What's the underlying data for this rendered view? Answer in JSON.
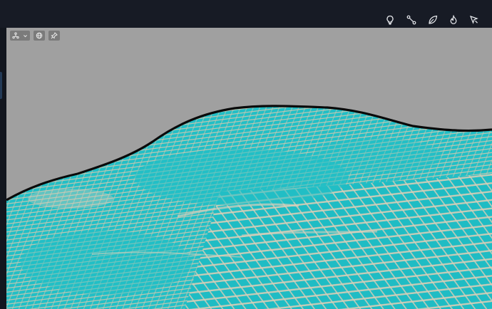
{
  "app": {
    "colors": {
      "topbar_bg": "#171b25",
      "viewport_bg": "#a0a0a0",
      "surface_cyan": "#22bfc6",
      "grid_light": "#d9cfba",
      "outline": "#0a0a0a"
    }
  },
  "toolbar": {
    "tools": [
      {
        "icon": "lightbulb-icon"
      },
      {
        "icon": "node-link-icon"
      },
      {
        "icon": "leaf-icon"
      },
      {
        "icon": "flame-icon"
      },
      {
        "icon": "pointer-flag-icon"
      }
    ]
  },
  "viewport": {
    "controls": [
      {
        "icon": "axis-gizmo-icon",
        "has_dropdown": true
      },
      {
        "icon": "globe-icon"
      },
      {
        "icon": "pin-icon"
      }
    ],
    "surface": {
      "description_color": "cyan",
      "mesh": "grid"
    }
  }
}
